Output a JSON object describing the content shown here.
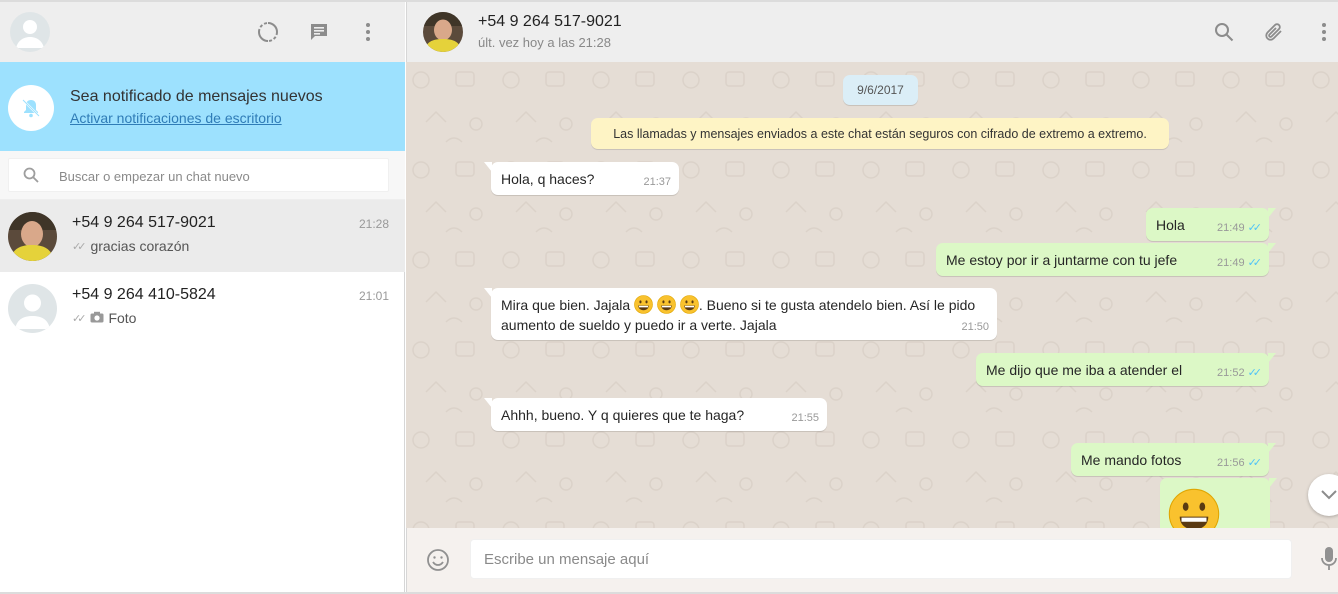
{
  "sidebar": {
    "notification": {
      "title": "Sea notificado de mensajes nuevos",
      "link": "Activar notificaciones de escritorio"
    },
    "search": {
      "placeholder": "Buscar o empezar un chat nuevo"
    },
    "chats": [
      {
        "name": "+54 9 264 517-9021",
        "time": "21:28",
        "last": "gracias corazón",
        "active": true
      },
      {
        "name": "+54 9 264 410-5824",
        "time": "21:01",
        "last": "Foto",
        "active": false
      }
    ]
  },
  "conversation": {
    "contact_name": "+54 9 264 517-9021",
    "contact_status": "últ. vez hoy a las 21:28",
    "date": "9/6/2017",
    "encryption_note": "Las llamadas y mensajes enviados a este chat están seguros con cifrado de extremo a extremo.",
    "messages": [
      {
        "dir": "in",
        "text": "Hola,  q haces?",
        "time": "21:37"
      },
      {
        "dir": "out",
        "text": "Hola",
        "time": "21:49"
      },
      {
        "dir": "out",
        "text": "Me estoy por ir a juntarme con tu jefe",
        "time": "21:49"
      },
      {
        "dir": "in",
        "text_a": "Mira que bien.  Jajala",
        "text_b": ".  Bueno si te gusta atendelo bien.  Así le pido",
        "text_c": "aumento de sueldo y puedo ir a verte.  Jajala",
        "time": "21:50"
      },
      {
        "dir": "out",
        "text": "Me dijo que me iba a atender el",
        "time": "21:52"
      },
      {
        "dir": "in",
        "text": "Ahhh, bueno. Y q quieres que te haga?",
        "time": "21:55"
      },
      {
        "dir": "out",
        "text": "Me mando fotos",
        "time": "21:56"
      }
    ]
  },
  "composer": {
    "placeholder": "Escribe un mensaje aquí"
  },
  "icons": {
    "status": "status-icon",
    "new_chat": "new-chat-icon",
    "menu": "menu-icon",
    "search": "search-icon",
    "attach": "paperclip-icon",
    "emoji": "emoji-icon",
    "mic": "mic-icon"
  },
  "colors": {
    "notification_bg": "#9de1fe",
    "outgoing_bubble": "#dcf8c6",
    "incoming_bubble": "#ffffff",
    "chat_bg": "#e5ddd5",
    "read_tick": "#4fc3f7"
  }
}
